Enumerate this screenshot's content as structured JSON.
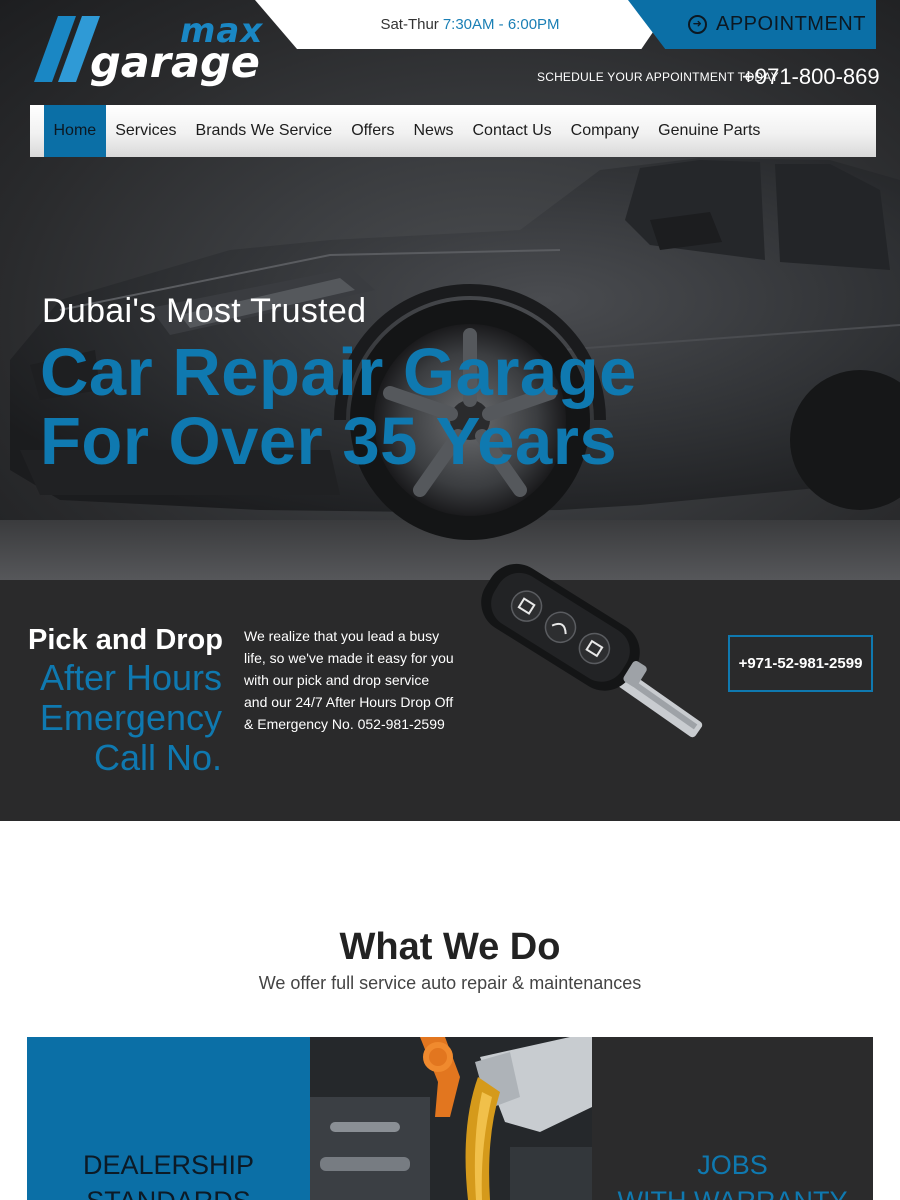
{
  "brand": {
    "logo_top": "max",
    "logo_bottom": "garage"
  },
  "topbar": {
    "hours_days": "Sat-Thur",
    "hours_time": "7:30AM - 6:00PM",
    "appointment_label": "APPOINTMENT",
    "schedule_text": "SCHEDULE YOUR APPOINTMENT TODAY",
    "schedule_phone": "+971-800-869"
  },
  "nav": {
    "items": [
      {
        "label": "Home",
        "active": true
      },
      {
        "label": "Services"
      },
      {
        "label": "Brands We Service"
      },
      {
        "label": "Offers"
      },
      {
        "label": "News"
      },
      {
        "label": "Contact Us"
      },
      {
        "label": "Company"
      },
      {
        "label": "Genuine Parts"
      }
    ]
  },
  "hero": {
    "kicker": "Dubai's Most Trusted",
    "title_line1": "Car Repair Garage",
    "title_line2": "For Over 35 Years"
  },
  "pickup": {
    "title": "Pick and Drop",
    "subtitle_line1": "After Hours",
    "subtitle_line2": "Emergency",
    "subtitle_line3": "Call No.",
    "description": "We realize that you lead a busy life, so we've made it easy for you with our pick and drop service and our 24/7 After Hours Drop Off & Emergency No. 052-981-2599",
    "phone_button": "+971-52-981-2599"
  },
  "what_we_do": {
    "title": "What We Do",
    "subtitle": "We offer full service auto repair & maintenances",
    "cards": [
      {
        "line1": "DEALERSHIP",
        "line2": "STANDARDS"
      },
      {
        "line1": "",
        "line2": ""
      },
      {
        "line1": "JOBS",
        "line2": "WITH WARRANTY"
      }
    ]
  },
  "colors": {
    "accent_blue": "#0f79b0",
    "nav_active": "#0b6fa6",
    "dark_band": "#2a2a2b"
  }
}
